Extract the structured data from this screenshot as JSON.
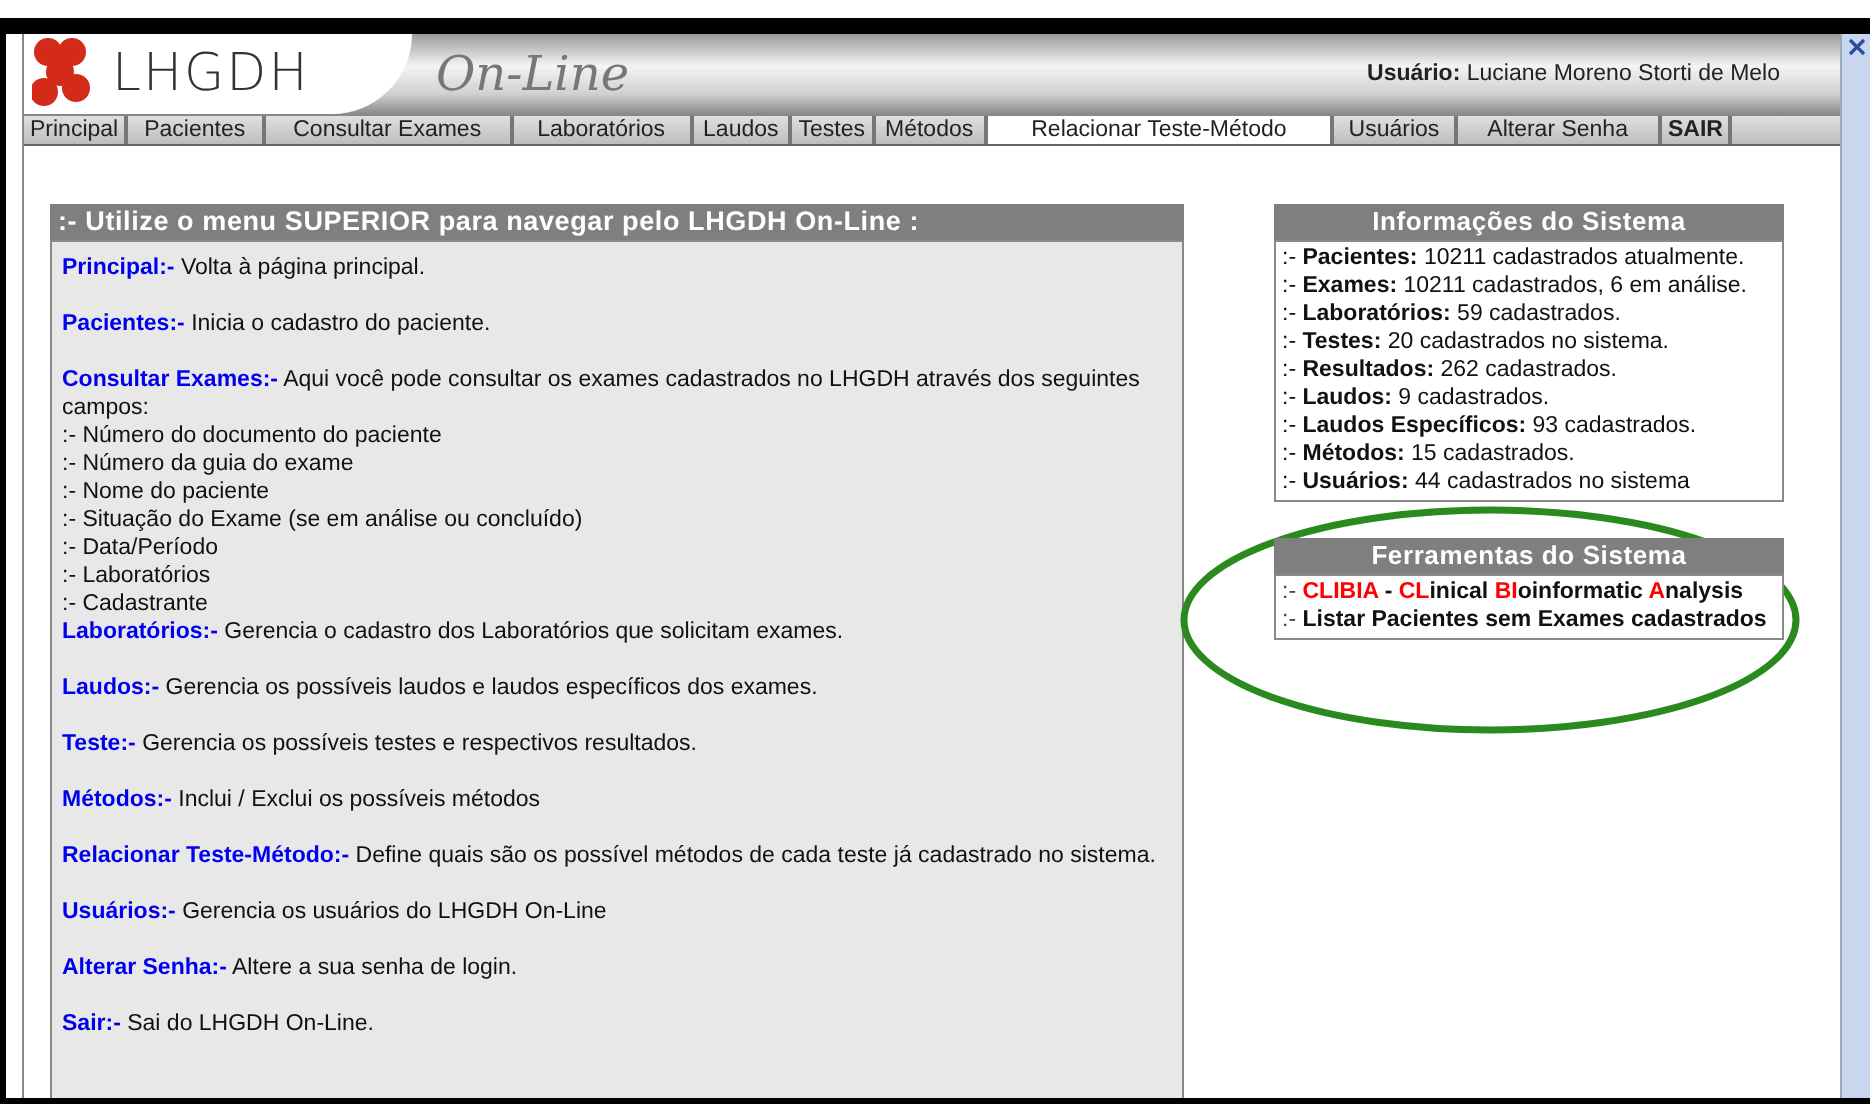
{
  "header": {
    "logo_text": "LHGDH",
    "site_title": "On-Line",
    "user_label": "Usuário:",
    "user_name": "Luciane Moreno Storti de Melo"
  },
  "menu": [
    {
      "label": "Principal",
      "selected": false,
      "bold": false
    },
    {
      "label": "Pacientes",
      "selected": false,
      "bold": false
    },
    {
      "label": "Consultar Exames",
      "selected": false,
      "bold": false
    },
    {
      "label": "Laboratórios",
      "selected": false,
      "bold": false
    },
    {
      "label": "Laudos",
      "selected": false,
      "bold": false
    },
    {
      "label": "Testes",
      "selected": false,
      "bold": false
    },
    {
      "label": "Métodos",
      "selected": false,
      "bold": false
    },
    {
      "label": "Relacionar Teste-Método",
      "selected": true,
      "bold": false
    },
    {
      "label": "Usuários",
      "selected": false,
      "bold": false
    },
    {
      "label": "Alterar Senha",
      "selected": false,
      "bold": false
    },
    {
      "label": "SAIR",
      "selected": false,
      "bold": true
    }
  ],
  "help_panel": {
    "title": ":- Utilize o menu SUPERIOR para navegar pelo LHGDH On-Line :",
    "items": [
      {
        "term": "Principal:-",
        "text": "Volta à página principal."
      },
      {
        "term": "Pacientes:-",
        "text": "Inicia o cadastro do paciente."
      },
      {
        "term": "Consultar Exames:-",
        "text": "Aqui você pode consultar os exames cadastrados no LHGDH através dos seguintes campos:",
        "lines": [
          ":- Número do documento do paciente",
          ":- Número da guia do exame",
          ":- Nome do paciente",
          ":- Situação do Exame (se em análise ou concluído)",
          ":- Data/Período",
          ":- Laboratórios",
          ":- Cadastrante"
        ]
      },
      {
        "term": "Laboratórios:-",
        "text": "Gerencia o cadastro dos Laboratórios que solicitam exames."
      },
      {
        "term": "Laudos:-",
        "text": "Gerencia os possíveis laudos e laudos específicos dos exames."
      },
      {
        "term": "Teste:-",
        "text": "Gerencia os possíveis testes e respectivos resultados."
      },
      {
        "term": "Métodos:-",
        "text": "Inclui / Exclui os possíveis métodos"
      },
      {
        "term": "Relacionar Teste-Método:-",
        "text": "Define quais são os possível métodos de cada teste já cadastrado no sistema."
      },
      {
        "term": "Usuários:-",
        "text": "Gerencia os usuários do LHGDH On-Line"
      },
      {
        "term": "Alterar Senha:-",
        "text": "Altere a sua senha de login."
      },
      {
        "term": "Sair:-",
        "text": "Sai do LHGDH On-Line."
      }
    ]
  },
  "info_panel": {
    "title": "Informações do Sistema",
    "items": [
      ":- **Pacientes:** 10211 cadastrados atualmente.",
      ":- **Exames:** 10211 cadastrados, 6 em análise.",
      ":- **Laboratórios:** 59 cadastrados.",
      ":- **Testes:** 20 cadastrados no sistema.",
      ":- **Resultados:** 262 cadastrados.",
      ":- **Laudos:** 9 cadastrados.",
      ":- **Laudos Específicos:** 93 cadastrados.",
      ":- **Métodos:** 15 cadastrados.",
      ":- **Usuários:** 44 cadastrados no sistema"
    ]
  },
  "tools_panel": {
    "title": "Ferramentas do Sistema",
    "highlighted": true,
    "tools": [
      {
        "segments": [
          {
            "text": ":- ",
            "red": false,
            "bold": false
          },
          {
            "text": "CLIBIA",
            "red": true,
            "bold": true
          },
          {
            "text": " - ",
            "red": false,
            "bold": true
          },
          {
            "text": "CL",
            "red": true,
            "bold": true
          },
          {
            "text": "inical ",
            "red": false,
            "bold": true
          },
          {
            "text": "BI",
            "red": true,
            "bold": true
          },
          {
            "text": "oinformatic ",
            "red": false,
            "bold": true
          },
          {
            "text": "A",
            "red": true,
            "bold": true
          },
          {
            "text": "nalysis",
            "red": false,
            "bold": true
          }
        ]
      },
      {
        "segments": [
          {
            "text": ":- ",
            "red": false,
            "bold": false
          },
          {
            "text": "Listar Pacientes sem Exames cadastrados",
            "red": false,
            "bold": true
          }
        ]
      }
    ]
  }
}
